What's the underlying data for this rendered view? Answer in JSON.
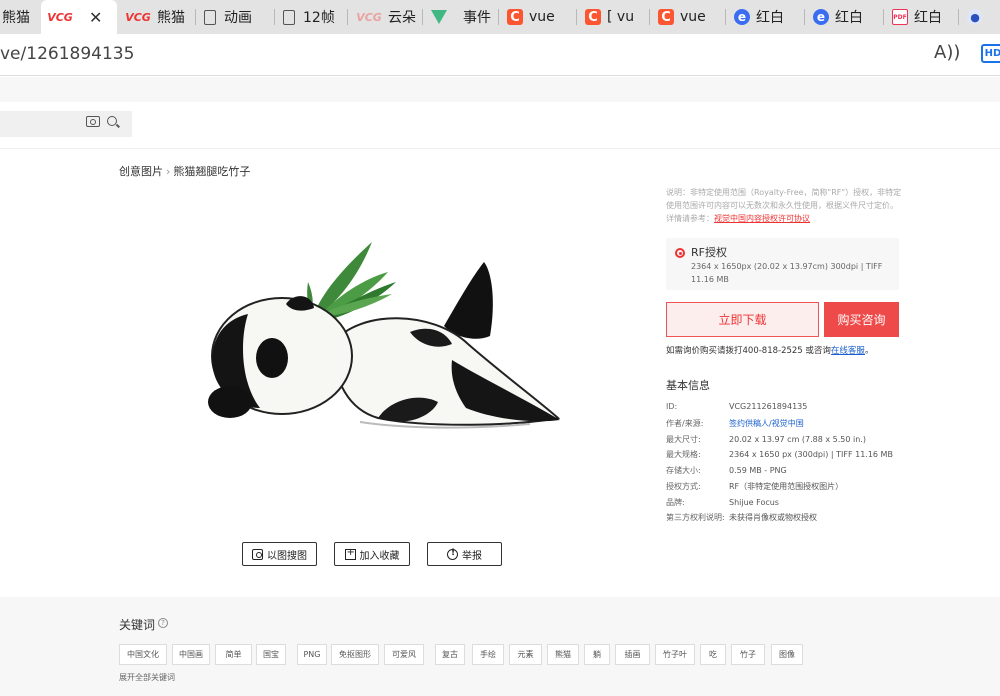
{
  "browser": {
    "tabs": [
      {
        "title": "熊猫",
        "icon": "browser-icon",
        "active": false
      },
      {
        "title": "",
        "icon": "vcg-logo-icon",
        "active": true,
        "close": "✕"
      },
      {
        "title": "熊猫",
        "icon": "vcg-logo-icon",
        "active": false
      },
      {
        "title": "动画",
        "icon": "document-icon",
        "active": false
      },
      {
        "title": "12帧",
        "icon": "document-icon",
        "active": false
      },
      {
        "title": "云朵",
        "icon": "vcg-logo-icon",
        "active": false
      },
      {
        "title": "事件",
        "icon": "vue-logo-icon",
        "active": false
      },
      {
        "title": "vue",
        "icon": "csdn-logo-icon",
        "active": false
      },
      {
        "title": "[ vu",
        "icon": "csdn-logo-icon",
        "active": false
      },
      {
        "title": "vue",
        "icon": "csdn-logo-icon",
        "active": false
      },
      {
        "title": "红白",
        "icon": "edge-icon",
        "active": false
      },
      {
        "title": "红白",
        "icon": "edge-icon",
        "active": false
      },
      {
        "title": "红白",
        "icon": "pdf-icon",
        "active": false
      },
      {
        "title": "",
        "icon": "baidu-paw-icon",
        "active": false
      }
    ],
    "url": "ve/1261894135",
    "read_aloud": "A",
    "hd_badge": "HD"
  },
  "breadcrumb": {
    "root": "创意图片",
    "separator": "›",
    "current": "熊猫翘腿吃竹子"
  },
  "actions": {
    "search_by_image": "以图搜图",
    "add_favorite": "加入收藏",
    "report": "举报"
  },
  "license": {
    "description": "说明：非特定使用范围（Royalty-Free，简称\"RF\"）授权，非特定使用范围许可内容可以无数次和永久性使用，根据义件尺寸定价。详情请参考：",
    "agreement_link": "视觉中国内容授权许可协议",
    "option_title": "RF授权",
    "option_detail": "2364 x 1650px (20.02 x 13.97cm) 300dpi | TIFF 11.16 MB"
  },
  "buttons": {
    "download": "立即下载",
    "buy": "购买咨询"
  },
  "inquiry": {
    "text": "如需询价购买请拨打400-818-2525 或咨询",
    "link": "在线客服",
    "end": "。"
  },
  "info": {
    "title": "基本信息",
    "rows": [
      {
        "k": "ID:",
        "v": "VCG211261894135"
      },
      {
        "k": "作者/来源:",
        "v": "签约供稿人/视觉中国",
        "link": true
      },
      {
        "k": "最大尺寸:",
        "v": "20.02 x 13.97 cm (7.88 x 5.50 in.)"
      },
      {
        "k": "最大规格:",
        "v": "2364 x 1650 px (300dpi) | TIFF 11.16 MB"
      },
      {
        "k": "存储大小:",
        "v": "0.59 MB - PNG"
      },
      {
        "k": "授权方式:",
        "v": "RF（非特定使用范围授权图片）"
      },
      {
        "k": "品牌:",
        "v": "Shijue Focus"
      },
      {
        "k": "第三方权利说明:",
        "v": "未获得肖像权或物权授权"
      }
    ]
  },
  "keywords": {
    "title": "关键词",
    "help": "?",
    "tags": [
      "中国文化",
      "中国画",
      "简单",
      "国宝",
      "PNG",
      "免抠图形",
      "可爱风",
      "复古",
      "手绘",
      "元素",
      "熊猫",
      "躺",
      "插画",
      "竹子叶",
      "吃",
      "竹子",
      "图像"
    ],
    "expand": "展开全部关键词"
  },
  "colors": {
    "accent": "#ef4a4a",
    "link": "#1a5fcf",
    "bamboo_green": "#3f8a3a"
  }
}
